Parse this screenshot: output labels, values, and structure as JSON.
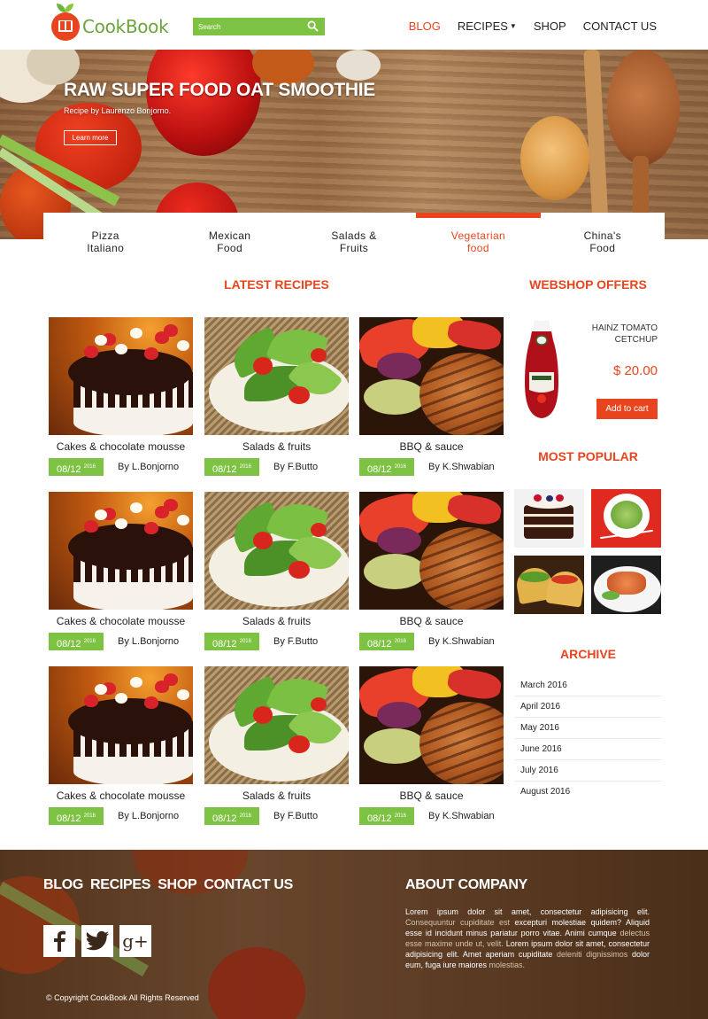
{
  "header": {
    "logo_text": "CookBook",
    "search_placeholder": "Search",
    "nav": [
      "BLOG",
      "RECIPES",
      "SHOP",
      "CONTACT US"
    ],
    "nav_active": "BLOG",
    "accent_color": "#e8451e",
    "green_color": "#7dc242"
  },
  "hero": {
    "title": "RAW SUPER FOOD OAT SMOOTHIE",
    "subtitle": "Recipe by Laurenzo Bonjorno.",
    "button": "Learn more"
  },
  "categories": [
    {
      "line1": "Pizza",
      "line2": "Italiano"
    },
    {
      "line1": "Mexican",
      "line2": "Food"
    },
    {
      "line1": "Salads &",
      "line2": "Fruits"
    },
    {
      "line1": "Vegetarian",
      "line2": "food"
    },
    {
      "line1": "China's",
      "line2": "Food"
    }
  ],
  "active_category": "Vegetarian food",
  "latest": {
    "title": "LATEST RECIPES",
    "cards": [
      {
        "title": "Cakes & chocolate mousse",
        "date": "08/12",
        "year": "2016",
        "author": "By L.Bonjorno"
      },
      {
        "title": "Salads & fruits",
        "date": "08/12",
        "year": "2016",
        "author": "By F.Butto"
      },
      {
        "title": "BBQ & sauce",
        "date": "08/12",
        "year": "2016",
        "author": "By K.Shwabian"
      },
      {
        "title": "Cakes & chocolate mousse",
        "date": "08/12",
        "year": "2016",
        "author": "By L.Bonjorno"
      },
      {
        "title": "Salads & fruits",
        "date": "08/12",
        "year": "2016",
        "author": "By F.Butto"
      },
      {
        "title": "BBQ & sauce",
        "date": "08/12",
        "year": "2016",
        "author": "By K.Shwabian"
      },
      {
        "title": "Cakes & chocolate mousse",
        "date": "08/12",
        "year": "2016",
        "author": "By L.Bonjorno"
      },
      {
        "title": "Salads & fruits",
        "date": "08/12",
        "year": "2016",
        "author": "By F.Butto"
      },
      {
        "title": "BBQ & sauce",
        "date": "08/12",
        "year": "2016",
        "author": "By K.Shwabian"
      }
    ]
  },
  "webshop": {
    "title": "WEBSHOP OFFERS",
    "product_name": "HAINZ TOMATO CETCHUP",
    "price": "$ 20.00",
    "button": "Add to cart"
  },
  "popular": {
    "title": "MOST POPULAR"
  },
  "archive": {
    "title": "ARCHIVE",
    "items": [
      "March 2016",
      "April 2016",
      "May 2016",
      "June 2016",
      "July 2016",
      "August 2016"
    ]
  },
  "footer": {
    "nav": [
      "BLOG",
      "RECIPES",
      "SHOP",
      "CONTACT US"
    ],
    "social": [
      "facebook-icon",
      "twitter-icon",
      "google-plus-icon"
    ],
    "copyright": "© Copyright CookBook All Rights Reserved",
    "about_title": "ABOUT COMPANY",
    "about_parts": [
      "Lorem ipsum dolor sit amet, consectetur adipisicing elit. ",
      "Consequuntur cupiditate est",
      " excepturi molestiae quidem? Aliquid esse id incidunt minus pariatur porro vitae. Animi cumque ",
      "delectus esse maxime unde ut, velit.",
      " Lorem ipsum dolor sit amet, consectetur adipisicing elit. Amet aperiam cupiditate ",
      "deleniti dignissimos",
      " dolor eum, fuga iure maiores ",
      "molestias."
    ]
  }
}
